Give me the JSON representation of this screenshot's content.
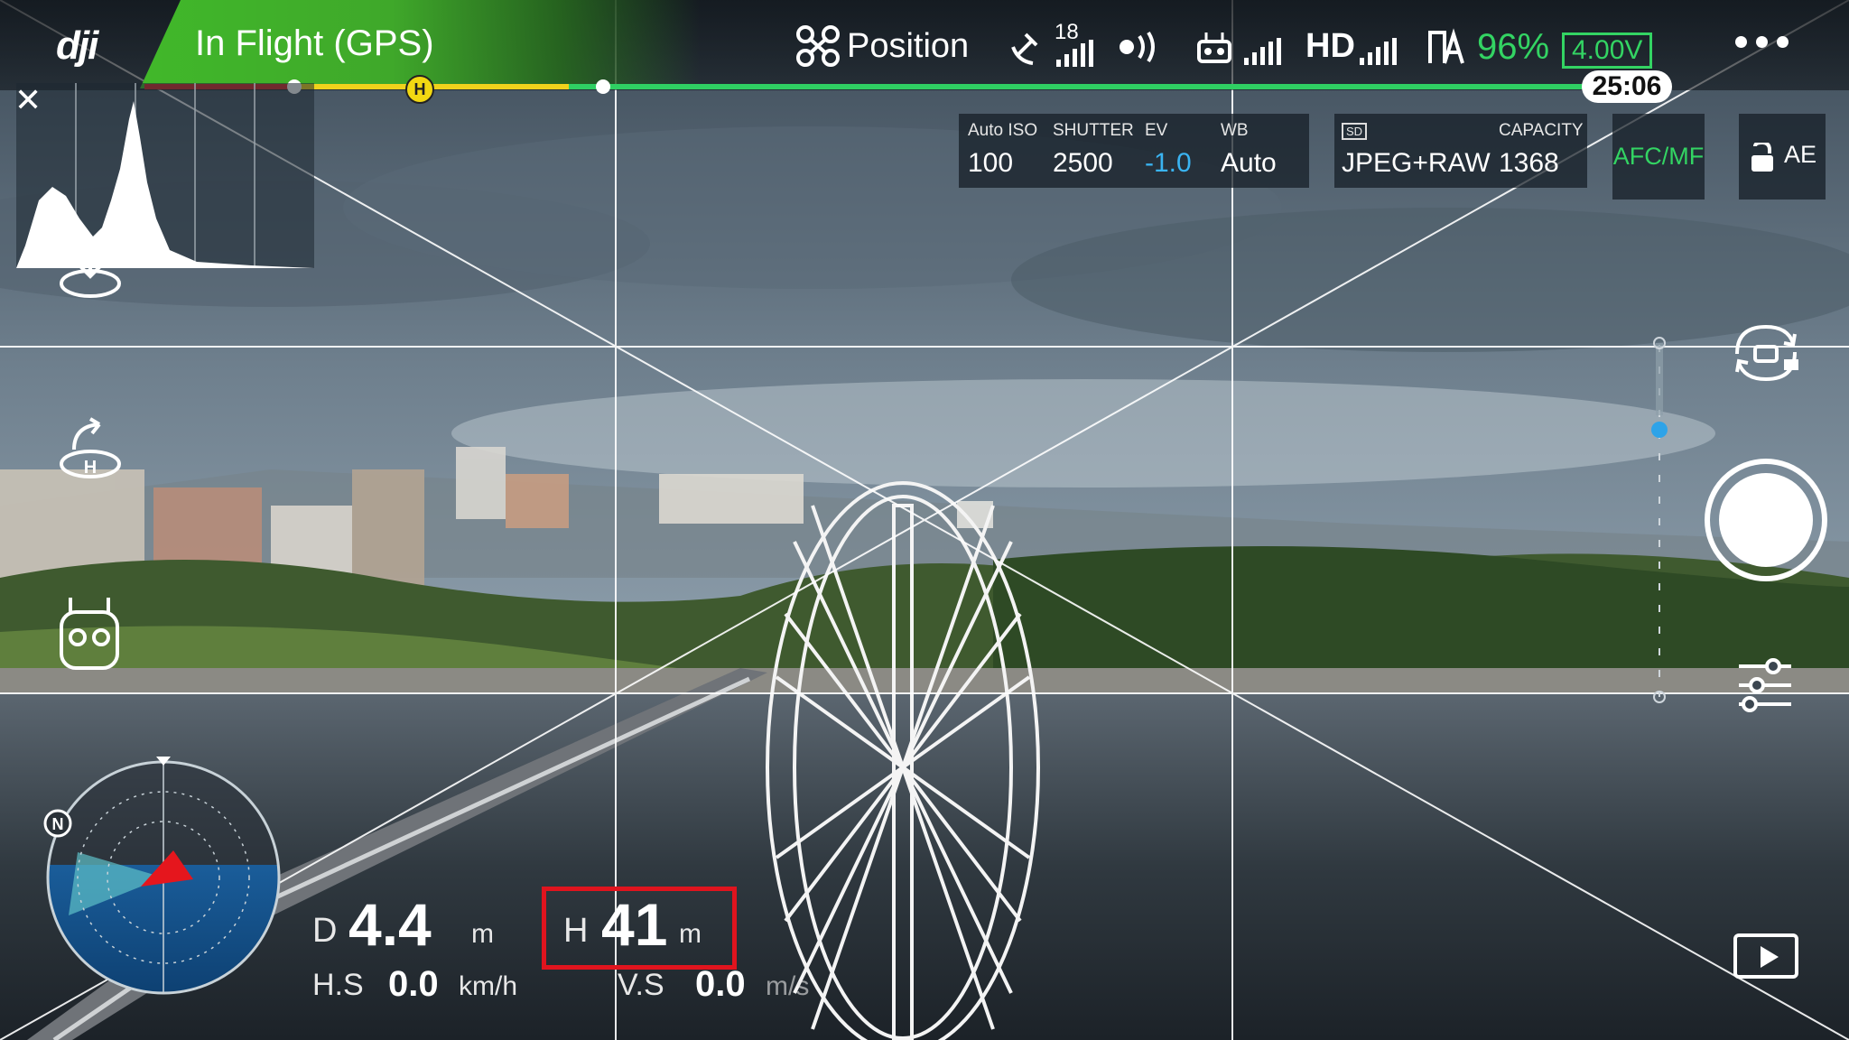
{
  "top_bar": {
    "logo": "dji",
    "flight_status": "In Flight (GPS)",
    "flight_mode": "Position",
    "satellite_count": "18",
    "transmission": "HD",
    "battery_percent": "96%",
    "battery_voltage": "4.00V",
    "remaining_time": "25:06",
    "home_point_label": "H"
  },
  "camera_params": {
    "iso_label": "Auto ISO",
    "iso_value": "100",
    "shutter_label": "SHUTTER",
    "shutter_value": "2500",
    "ev_label": "EV",
    "ev_value": "-1.0",
    "wb_label": "WB",
    "wb_value": "Auto",
    "storage_label": "SD",
    "format_value": "JPEG+RAW",
    "capacity_label": "CAPACITY",
    "capacity_value": "1368",
    "focus_mode": "AFC/MF",
    "ae_lock": "AE"
  },
  "telemetry": {
    "distance_label": "D",
    "distance_value": "4.4",
    "distance_unit": "m",
    "height_label": "H",
    "height_value": "41",
    "height_unit": "m",
    "hspeed_label": "H.S",
    "hspeed_value": "0.0",
    "hspeed_unit": "km/h",
    "vspeed_label": "V.S",
    "vspeed_value": "0.0",
    "vspeed_unit": "m/s"
  },
  "radar": {
    "north_label": "N"
  },
  "colors": {
    "accent_green": "#33d463",
    "status_green": "#41b82a",
    "ev_blue": "#3ab4f2",
    "highlight_red": "#e0141e"
  },
  "icons": [
    "close-icon",
    "download-icon",
    "return-home-icon",
    "robot-face-icon",
    "drone-icon",
    "satellite-icon",
    "remote-signal-icon",
    "controller-icon",
    "battery-icon",
    "camera-switch-icon",
    "shutter-button",
    "settings-sliders-icon",
    "playback-icon",
    "menu-dots-icon",
    "lock-icon"
  ]
}
